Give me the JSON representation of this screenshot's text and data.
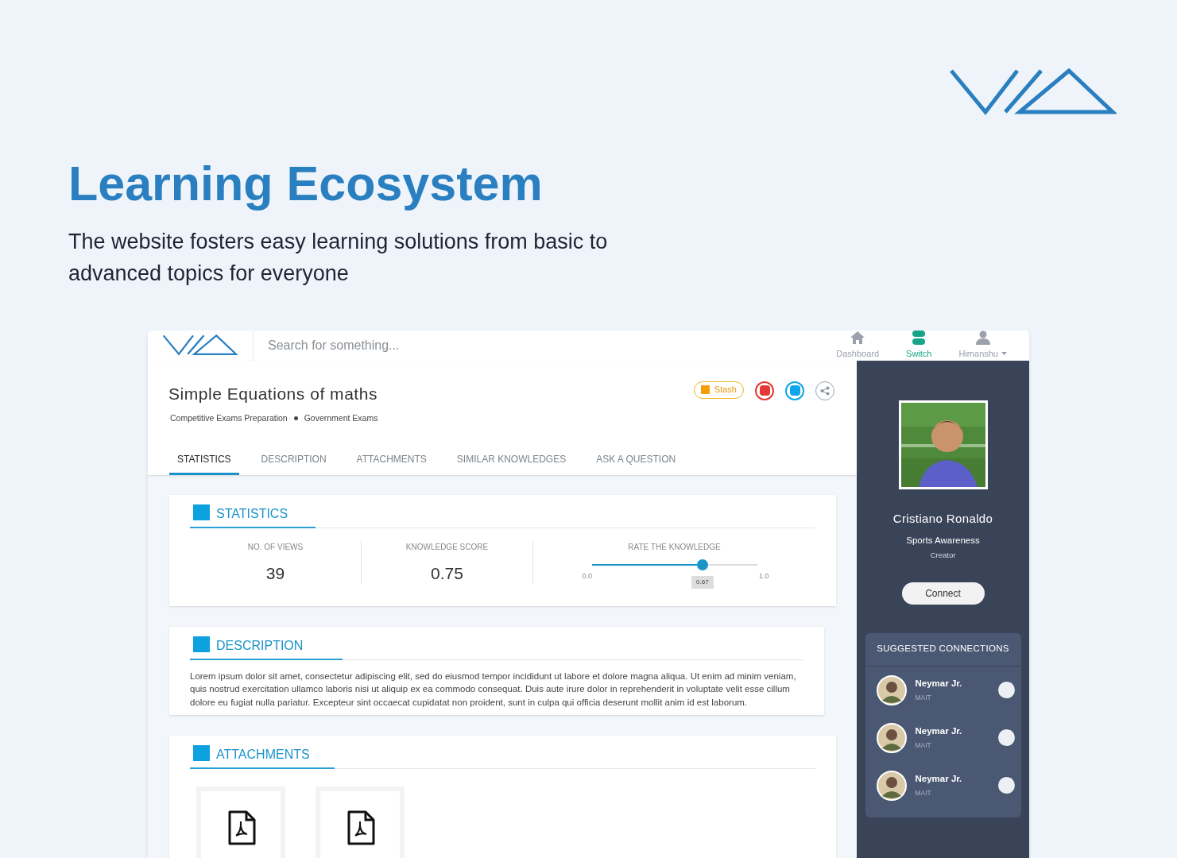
{
  "hero": {
    "title": "Learning Ecosystem",
    "subtitle": "The website fosters easy learning solutions from basic to advanced topics for everyone"
  },
  "header": {
    "search": {
      "placeholder": "Search for something..."
    },
    "nav": [
      {
        "label": "Dashboard",
        "kind": "home",
        "selected": false
      },
      {
        "label": "Switch",
        "kind": "switch",
        "selected": true
      },
      {
        "label": "Himanshu",
        "kind": "user",
        "selected": false
      }
    ]
  },
  "content": {
    "title": "Simple Equations of maths",
    "tags": [
      "Competitive Exams Preparation",
      "Government Exams"
    ],
    "actions": [
      {
        "kind": "stash",
        "label": "Stash",
        "color": "#f59e0b"
      },
      {
        "kind": "square",
        "color": "#e53935"
      },
      {
        "kind": "square",
        "color": "#0ea5e9"
      },
      {
        "kind": "share"
      }
    ],
    "tabs": [
      {
        "label": "STATISTICS",
        "selected": true
      },
      {
        "label": "DESCRIPTION",
        "selected": false
      },
      {
        "label": "ATTACHMENTS",
        "selected": false
      },
      {
        "label": "SIMILAR KNOWLEDGES",
        "selected": false
      },
      {
        "label": "ASK A QUESTION",
        "selected": false
      }
    ]
  },
  "statistics": {
    "heading": "STATISTICS",
    "views": {
      "label": "NO. OF VIEWS",
      "value": "39"
    },
    "score": {
      "label": "KNOWLEDGE SCORE",
      "value": "0.75"
    },
    "rating": {
      "label": "RATE THE KNOWLEDGE",
      "level": 0.67,
      "min": "0.0",
      "max": "1.0",
      "reading": "0.67"
    }
  },
  "description": {
    "heading": "DESCRIPTION",
    "text": "Lorem ipsum dolor sit amet, consectetur adipiscing elit, sed do eiusmod tempor incididunt ut labore et dolore magna aliqua. Ut enim ad minim veniam, quis nostrud exercitation ullamco laboris nisi ut aliquip ex ea commodo consequat. Duis aute irure dolor in reprehenderit in voluptate velit esse cillum dolore eu fugiat nulla pariatur. Excepteur sint occaecat cupidatat non proident, sunt in culpa qui officia deserunt mollit anim id est laborum."
  },
  "attachments": {
    "heading": "ATTACHMENTS",
    "files": [
      {
        "kind": "pdf"
      },
      {
        "kind": "pdf"
      }
    ]
  },
  "profile": {
    "name": "Cristiano Ronaldo",
    "topic": "Sports Awareness",
    "role": "Creator",
    "button": "Connect"
  },
  "suggested": {
    "heading": "SUGGESTED CONNECTIONS",
    "people": [
      {
        "name": "Neymar Jr.",
        "org": "MAIT",
        "selected": false
      },
      {
        "name": "Neymar Jr.",
        "org": "MAIT",
        "selected": false
      },
      {
        "name": "Neymar Jr.",
        "org": "MAIT",
        "selected": false
      }
    ]
  }
}
